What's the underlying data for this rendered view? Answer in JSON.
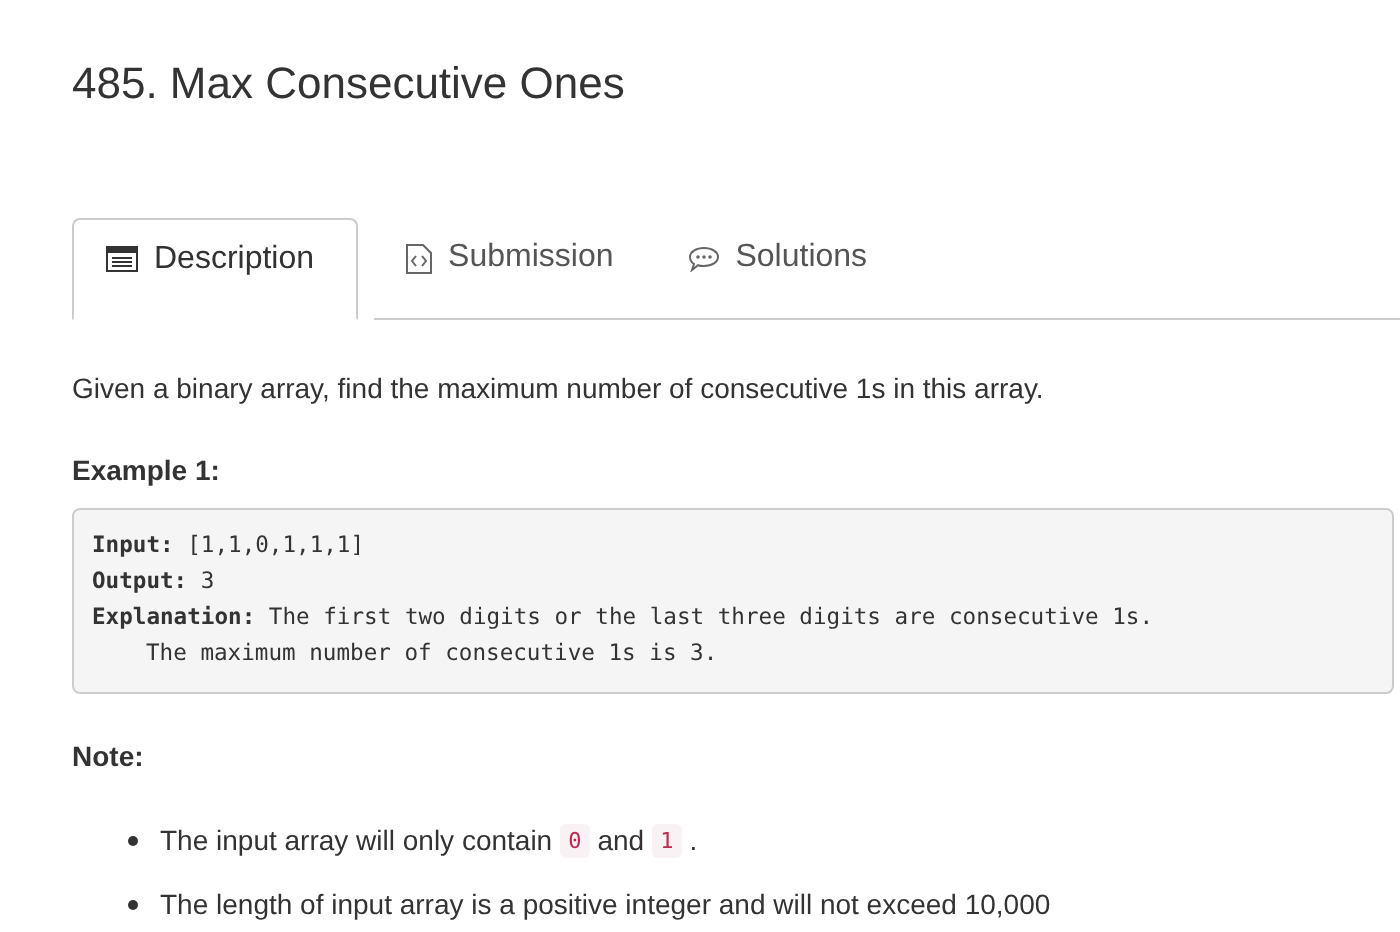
{
  "title": "485. Max Consecutive Ones",
  "tabs": [
    {
      "label": "Description",
      "kind": "list",
      "selected": true
    },
    {
      "label": "Submission",
      "kind": "file",
      "selected": false
    },
    {
      "label": "Solutions",
      "kind": "chat",
      "selected": false
    }
  ],
  "description": "Given a binary array, find the maximum number of consecutive 1s in this array.",
  "example": {
    "heading": "Example 1:",
    "lines": [
      {
        "text": "**Input:** [1,1,0,1,1,1]",
        "indented": false
      },
      {
        "text": "**Output:** 3",
        "indented": false
      },
      {
        "text": "**Explanation:** The first two digits or the last three digits are consecutive 1s.",
        "indented": false
      },
      {
        "text": "The maximum number of consecutive 1s is 3.",
        "indented": true
      }
    ]
  },
  "note": {
    "heading": "Note:",
    "items": [
      [
        {
          "kind": "text",
          "text": "The input array will only contain"
        },
        {
          "kind": "code",
          "text": "0"
        },
        {
          "kind": "text",
          "text": "and"
        },
        {
          "kind": "code",
          "text": "1"
        },
        {
          "kind": "text",
          "text": "."
        }
      ],
      [
        {
          "kind": "text",
          "text": "The length of input array is a positive integer and will not exceed 10,000"
        }
      ]
    ]
  }
}
